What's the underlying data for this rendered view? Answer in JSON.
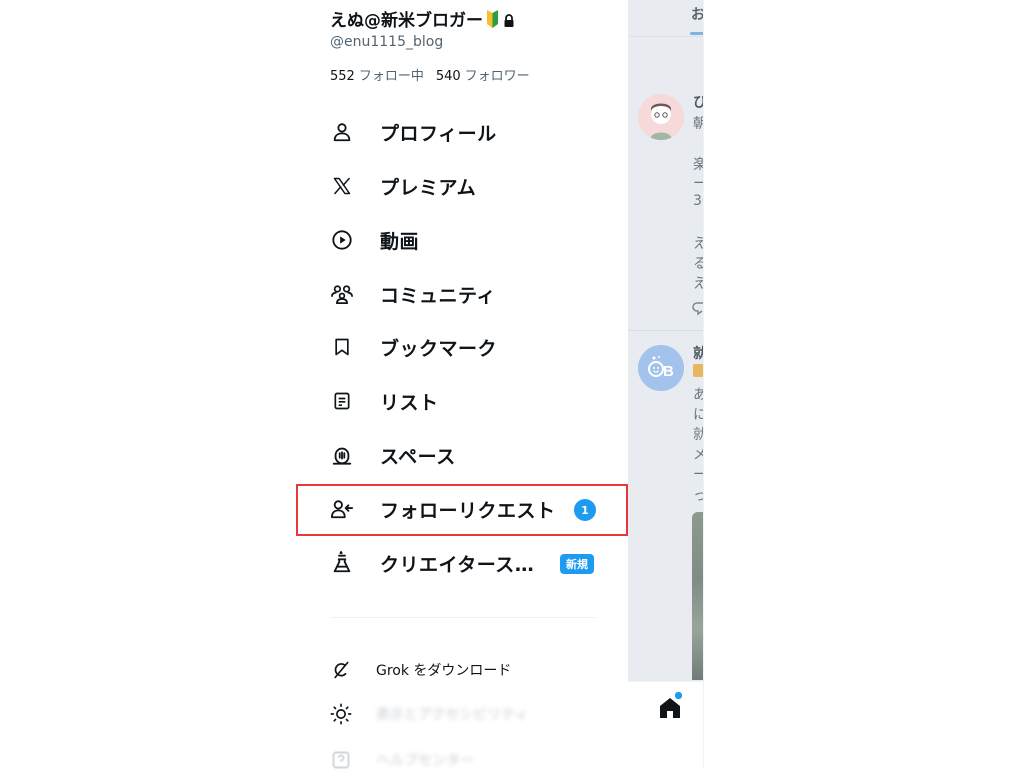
{
  "profile": {
    "name": "えぬ@新米ブロガー",
    "handle": "@enu1115_blog",
    "following_count": "552",
    "following_label": "フォロー中",
    "followers_count": "540",
    "followers_label": "フォロワー"
  },
  "menu": [
    {
      "label": "プロフィール",
      "icon": "person-icon"
    },
    {
      "label": "プレミアム",
      "icon": "x-logo-icon"
    },
    {
      "label": "動画",
      "icon": "play-icon"
    },
    {
      "label": "コミュニティ",
      "icon": "communities-icon"
    },
    {
      "label": "ブックマーク",
      "icon": "bookmark-icon"
    },
    {
      "label": "リスト",
      "icon": "list-icon"
    },
    {
      "label": "スペース",
      "icon": "spaces-icon"
    },
    {
      "label": "フォローリクエスト",
      "icon": "follow-request-icon",
      "badge": "1"
    },
    {
      "label": "クリエイタース…",
      "icon": "creator-studio-icon",
      "badge": "新規"
    }
  ],
  "secondary": [
    {
      "label": "Grok をダウンロード",
      "icon": "grok-icon"
    },
    {
      "label": "表示とアクセシビリティ",
      "icon": "sun-icon"
    },
    {
      "label": "ヘルプセンター",
      "icon": "help-icon"
    }
  ],
  "feed": {
    "tab_fragment": "お",
    "post1_lines": [
      "ひ",
      "朝",
      "楽",
      "ー",
      "30",
      "え",
      "る",
      "え"
    ],
    "post2_lines": [
      "就",
      "あ",
      "に",
      "就",
      "メ",
      "ー",
      "っ"
    ]
  },
  "colors": {
    "accent": "#1d9bf0",
    "highlight": "#e5393b",
    "text": "#0f1419",
    "muted": "#536471"
  }
}
